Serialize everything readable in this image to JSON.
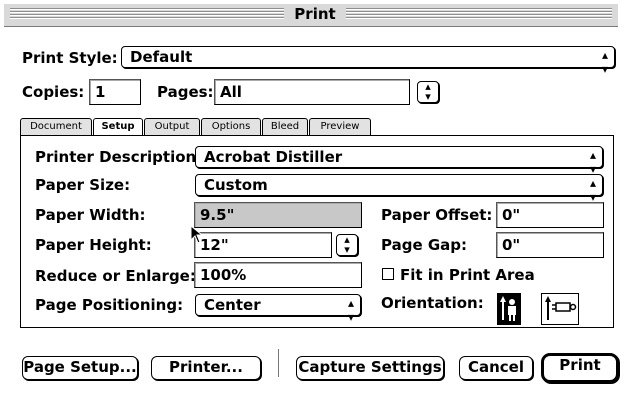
{
  "window": {
    "title": "Print"
  },
  "print_style": {
    "label": "Print Style:",
    "value": "Default"
  },
  "copies": {
    "label": "Copies:",
    "value": "1"
  },
  "pages": {
    "label": "Pages:",
    "value": "All"
  },
  "tabs": [
    {
      "label": "Document",
      "active": false
    },
    {
      "label": "Setup",
      "active": true
    },
    {
      "label": "Output",
      "active": false
    },
    {
      "label": "Options",
      "active": false
    },
    {
      "label": "Bleed",
      "active": false
    },
    {
      "label": "Preview",
      "active": false
    }
  ],
  "setup": {
    "printer_description": {
      "label": "Printer Description:",
      "value": "Acrobat Distiller"
    },
    "paper_size": {
      "label": "Paper Size:",
      "value": "Custom"
    },
    "paper_width": {
      "label": "Paper Width:",
      "value": "9.5\""
    },
    "paper_height": {
      "label": "Paper Height:",
      "value": "12\""
    },
    "reduce_enlarge": {
      "label": "Reduce or Enlarge:",
      "value": "100%"
    },
    "page_positioning": {
      "label": "Page Positioning:",
      "value": "Center"
    },
    "paper_offset": {
      "label": "Paper Offset:",
      "value": "0\""
    },
    "page_gap": {
      "label": "Page Gap:",
      "value": "0\""
    },
    "fit_in_print_area": {
      "label": "Fit in Print Area",
      "checked": false
    },
    "orientation": {
      "label": "Orientation:",
      "selected": "portrait"
    }
  },
  "buttons": {
    "page_setup": "Page Setup...",
    "printer": "Printer...",
    "capture_settings": "Capture Settings",
    "cancel": "Cancel",
    "print": "Print"
  },
  "icons": {
    "popup_arrows": "⇕",
    "up_down": "updown-arrow-icon"
  }
}
